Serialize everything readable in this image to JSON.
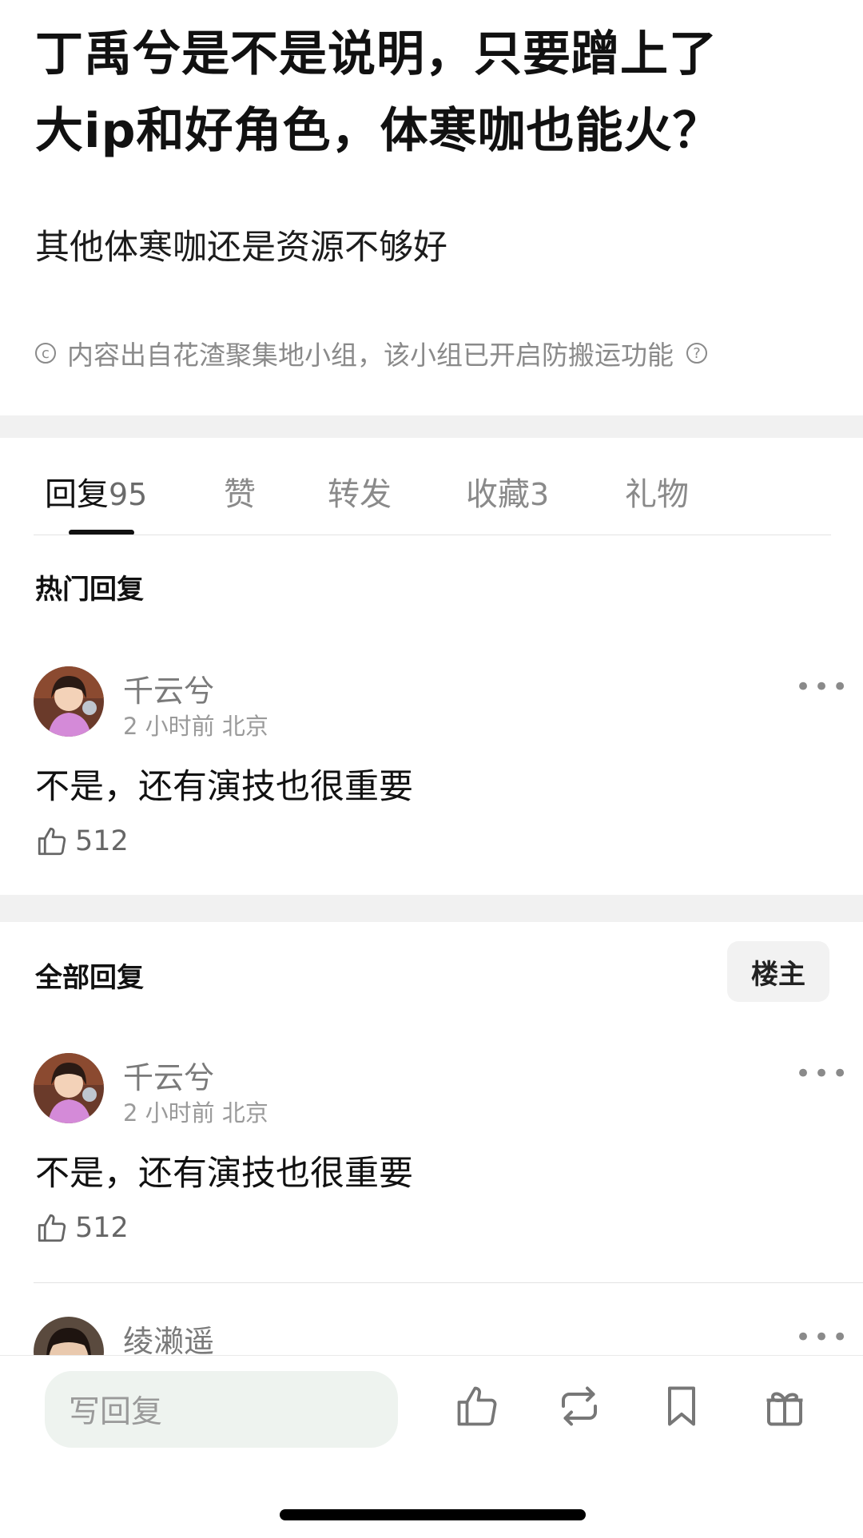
{
  "post": {
    "title_line1": "丁禹兮是不是说明，只要蹭上了",
    "title_line2": "大ip和好角色，体寒咖也能火？",
    "body": "其他体寒咖还是资源不够好",
    "copyright_text": "内容出自花渣聚集地小组，该小组已开启防搬运功能"
  },
  "tabs": [
    {
      "label": "回复",
      "count": "95",
      "active": true
    },
    {
      "label": "赞",
      "count": ""
    },
    {
      "label": "转发",
      "count": ""
    },
    {
      "label": "收藏",
      "count": "3"
    },
    {
      "label": "礼物",
      "count": ""
    }
  ],
  "hot_section": {
    "title": "热门回复"
  },
  "all_section": {
    "title": "全部回复",
    "owner_button": "楼主"
  },
  "comments": [
    {
      "user": "千云兮",
      "time": "2 小时前",
      "location": "北京",
      "text": "不是，还有演技也很重要",
      "likes": "512"
    },
    {
      "user": "千云兮",
      "time": "2 小时前",
      "location": "北京",
      "text": "不是，还有演技也很重要",
      "likes": "512"
    },
    {
      "user": "绫濑遥"
    }
  ],
  "bottom_bar": {
    "reply_placeholder": "写回复"
  },
  "icons": [
    "copyright-icon",
    "help-icon",
    "thumb-up-icon",
    "more-icon",
    "like-icon",
    "repost-icon",
    "bookmark-icon",
    "gift-icon"
  ],
  "colors": {
    "accent": "#111111",
    "muted": "#8a8a8a",
    "input_bg": "#eef3ef",
    "band": "#f1f1f1"
  }
}
